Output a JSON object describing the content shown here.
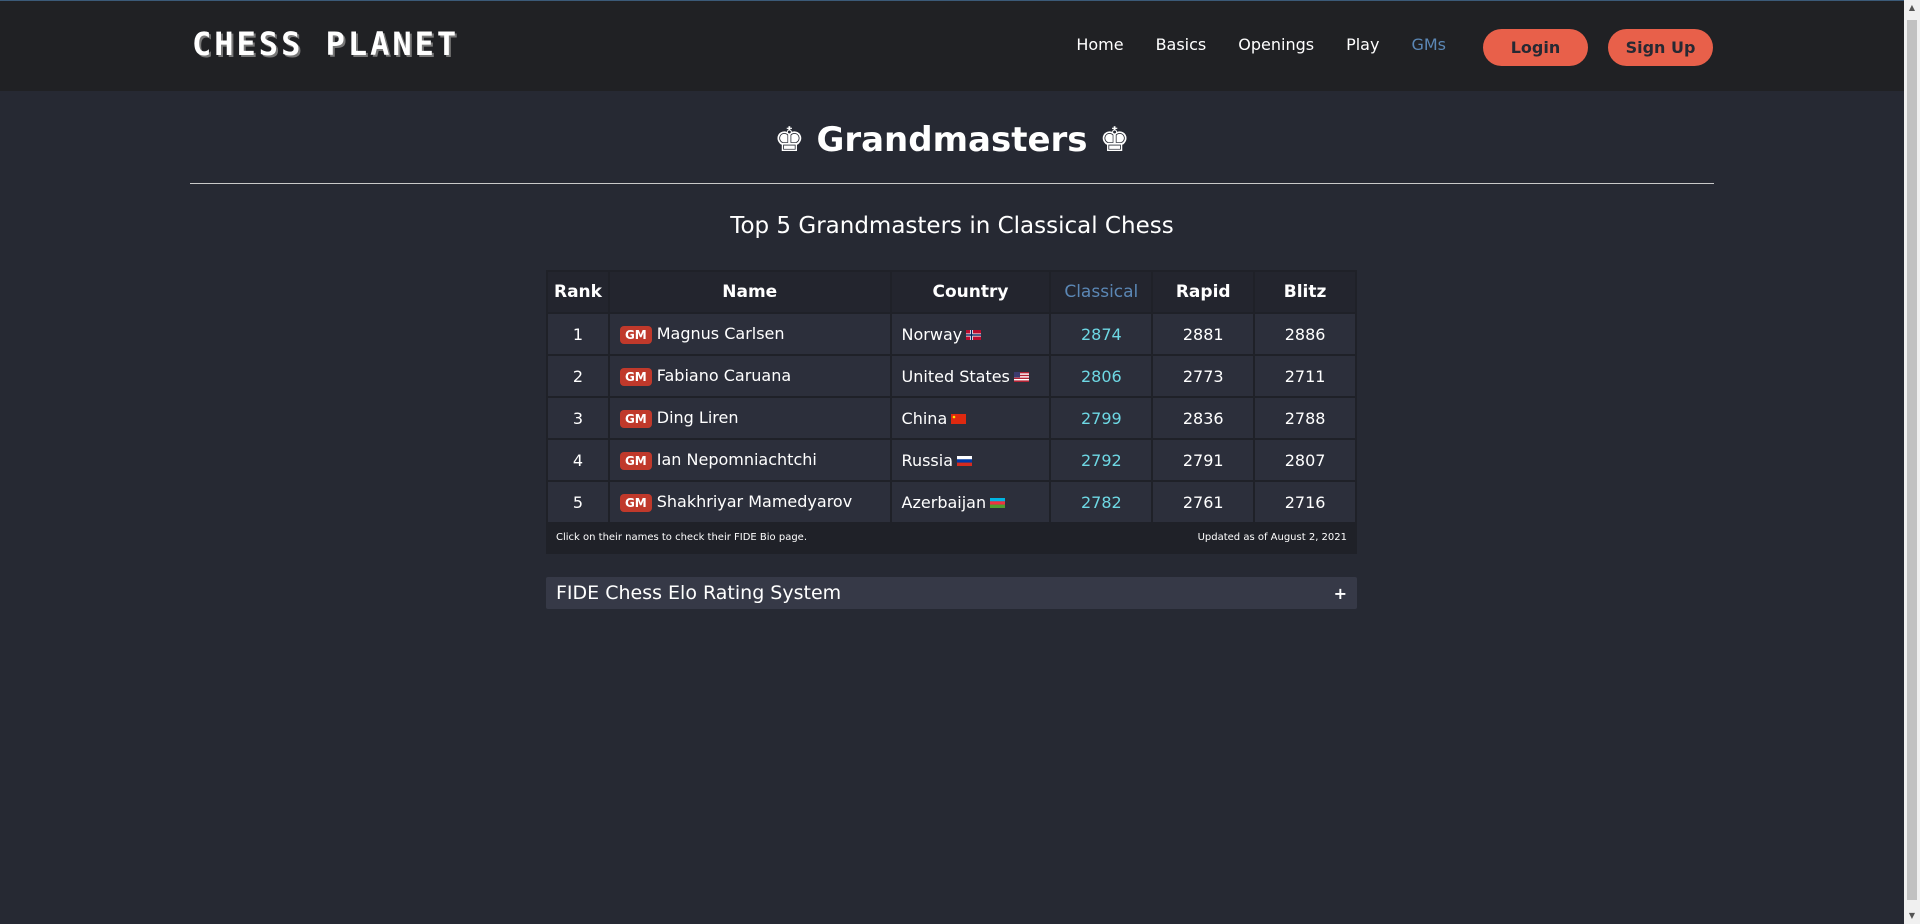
{
  "nav": {
    "logo": "CHESS PLANET",
    "links": [
      "Home",
      "Basics",
      "Openings",
      "Play",
      "GMs"
    ],
    "active": "GMs",
    "login": "Login",
    "signup": "Sign Up"
  },
  "page": {
    "title": "♚ Grandmasters ♚",
    "subtitle": "Top 5 Grandmasters in Classical Chess"
  },
  "table": {
    "headers": [
      "Rank",
      "Name",
      "Country",
      "Classical",
      "Rapid",
      "Blitz"
    ],
    "badge": "GM",
    "rows": [
      {
        "rank": "1",
        "name": "Magnus Carlsen",
        "country": "Norway",
        "flag": "norway",
        "classical": "2874",
        "rapid": "2881",
        "blitz": "2886"
      },
      {
        "rank": "2",
        "name": "Fabiano Caruana",
        "country": "United States",
        "flag": "usa",
        "classical": "2806",
        "rapid": "2773",
        "blitz": "2711"
      },
      {
        "rank": "3",
        "name": "Ding Liren",
        "country": "China",
        "flag": "china",
        "classical": "2799",
        "rapid": "2836",
        "blitz": "2788"
      },
      {
        "rank": "4",
        "name": "Ian Nepomniachtchi",
        "country": "Russia",
        "flag": "russia",
        "classical": "2792",
        "rapid": "2791",
        "blitz": "2807"
      },
      {
        "rank": "5",
        "name": "Shakhriyar Mamedyarov",
        "country": "Azerbaijan",
        "flag": "azerbaijan",
        "classical": "2782",
        "rapid": "2761",
        "blitz": "2716"
      }
    ],
    "footnote_left": "Click on their names to check their FIDE Bio page.",
    "footnote_right": "Updated as of August 2, 2021"
  },
  "accordion": {
    "title": "FIDE Chess Elo Rating System",
    "toggle": "+"
  },
  "colors": {
    "accent": "#e8604a",
    "active_link": "#5b87b5",
    "classical": "#6ed8e4",
    "badge": "#c0392b"
  }
}
